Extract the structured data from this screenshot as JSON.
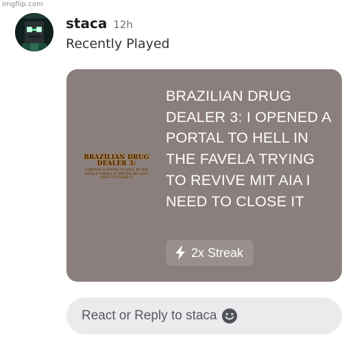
{
  "watermark": "imgflip.com",
  "message": {
    "username": "staca",
    "timestamp": "12h",
    "activity_label": "Recently Played",
    "avatar_icon": "pixel-robot-avatar-icon"
  },
  "card": {
    "background_color": "#8b7f7d",
    "thumbnail": {
      "title_line1": "BRAZILIAN DRUG",
      "title_line2": "DEALER 3:",
      "body": "I OPENED A PORTAL TO HELL IN THE FAVELA TRYING TO REVIVE MIT AIA I NEED TO CLOSE IT"
    },
    "game_title": "BRAZILIAN DRUG DEALER 3: I OPENED A PORTAL TO HELL IN THE FAVELA TRYING TO REVIVE MIT AIA I NEED TO CLOSE IT",
    "streak": {
      "icon": "lightning-bolt-icon",
      "label": "2x Streak"
    }
  },
  "reply": {
    "placeholder": "React or Reply to staca",
    "icon": "emoji-smile-icon"
  }
}
